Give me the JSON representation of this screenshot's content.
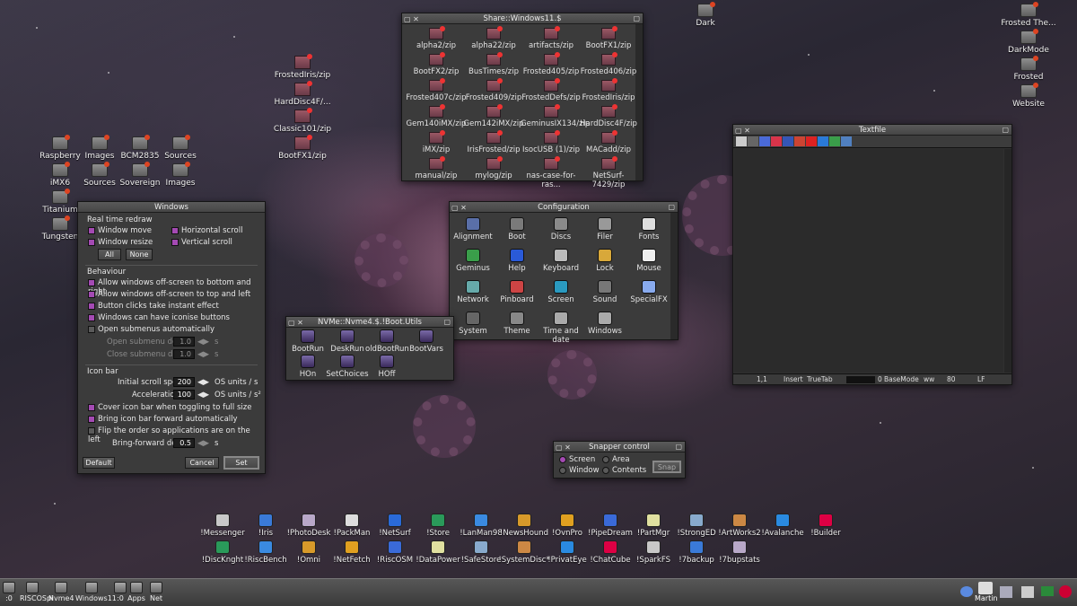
{
  "desktop": {
    "left_icons": [
      "Raspberry",
      "Images",
      "BCM2835",
      "Sources",
      "iMX6",
      "Sources",
      "Sovereign",
      "Images",
      "Titanium",
      "Tungsten"
    ],
    "pinned_zips": [
      "FrostedIris/zip",
      "HardDisc4F/...",
      "Classic101/zip",
      "BootFX1/zip"
    ],
    "top_right_icons": [
      "Dark",
      "Frosted The...",
      "DarkMode",
      "Frosted",
      "Website"
    ]
  },
  "share_window": {
    "title": "Share::Windows11.$",
    "items": [
      "alpha2/zip",
      "alpha22/zip",
      "artifacts/zip",
      "BootFX1/zip",
      "BootFX2/zip",
      "BusTimes/zip",
      "Frosted405/zip",
      "Frosted406/zip",
      "Frosted407c/zip",
      "Frosted409/zip",
      "FrostedDefs/zip",
      "FrostedIris/zip",
      "Gem140iMX/zip",
      "Gem142iMX/zip",
      "GeminusIX134/zip",
      "HardDisc4F/zip",
      "iMX/zip",
      "IrisFrosted/zip",
      "IsocUSB (1)/zip",
      "MACadd/zip",
      "manual/zip",
      "mylog/zip",
      "nas-case-for-ras...",
      "NetSurf-7429/zip"
    ]
  },
  "windows_dialog": {
    "title": "Windows",
    "realtime_label": "Real time redraw",
    "window_move": "Window move",
    "window_resize": "Window resize",
    "horizontal_scroll": "Horizontal scroll",
    "vertical_scroll": "Vertical scroll",
    "all_btn": "All",
    "none_btn": "None",
    "behaviour_label": "Behaviour",
    "behaviour_opts": [
      "Allow windows off-screen to bottom and right",
      "Allow windows off-screen to top and left",
      "Button clicks take instant effect",
      "Windows can have iconise buttons",
      "Open submenus automatically"
    ],
    "open_delay_label": "Open submenu delay",
    "open_delay_val": "1.0",
    "close_delay_label": "Close submenu delay",
    "close_delay_val": "1.0",
    "unit_s": "s",
    "iconbar_label": "Icon bar",
    "init_speed_label": "Initial scroll speed",
    "init_speed_val": "200",
    "init_speed_unit": "OS units / s",
    "accel_label": "Acceleration",
    "accel_val": "100",
    "accel_unit": "OS units / s²",
    "iconbar_opts": [
      "Cover icon bar when toggling to full size",
      "Bring icon bar forward automatically",
      "Flip the order so applications are on the left"
    ],
    "bring_fwd_label": "Bring-forward delay",
    "bring_fwd_val": "0.5",
    "default_btn": "Default",
    "cancel_btn": "Cancel",
    "set_btn": "Set"
  },
  "config_window": {
    "title": "Configuration",
    "items": [
      "Alignment",
      "Boot",
      "Discs",
      "Filer",
      "Fonts",
      "Geminus",
      "Help",
      "Keyboard",
      "Lock",
      "Mouse",
      "Network",
      "Pinboard",
      "Screen",
      "Sound",
      "SpecialFX",
      "System",
      "Theme",
      "Time and date",
      "Windows"
    ]
  },
  "boot_utils": {
    "title": "NVMe::Nvme4.$.!Boot.Utils",
    "items": [
      "BootRun",
      "DeskRun",
      "oldBootRun",
      "BootVars",
      "HOn",
      "SetChoices",
      "HOff"
    ]
  },
  "textfile": {
    "title": "Textfile",
    "status": [
      "1,1",
      "Insert",
      "TrueTab",
      "0",
      "BaseMode",
      "ww",
      "80",
      "LF"
    ]
  },
  "snapper": {
    "title": "Snapper control",
    "screen": "Screen",
    "area": "Area",
    "window": "Window",
    "contents": "Contents",
    "snap_btn": "Snap"
  },
  "iconbar_apps_row1": [
    "!Messenger",
    "!Iris",
    "!PhotoDesk",
    "!PackMan",
    "!NetSurf",
    "!Store",
    "!LanMan98",
    "!NewsHound",
    "!OvnPro",
    "!PipeDream",
    "!PartMgr",
    "!StrongED",
    "!ArtWorks2",
    "!Avalanche",
    "!Builder"
  ],
  "iconbar_apps_row2": [
    "!DiscKnght",
    "!RiscBench",
    "!Omni",
    "!NetFetch",
    "!RiscOSM",
    "!DataPower",
    "!SafeStore",
    "!SystemDisc*",
    "!PrivatEye",
    "!ChatCube",
    "!SparkFS",
    "!7backup",
    "!7bupstats"
  ],
  "taskbar": {
    "left": [
      ":0",
      "RISCOSpi",
      "Nvme4",
      "Windows11",
      ":0",
      "Apps",
      "Net"
    ],
    "right_user": "Martin"
  }
}
